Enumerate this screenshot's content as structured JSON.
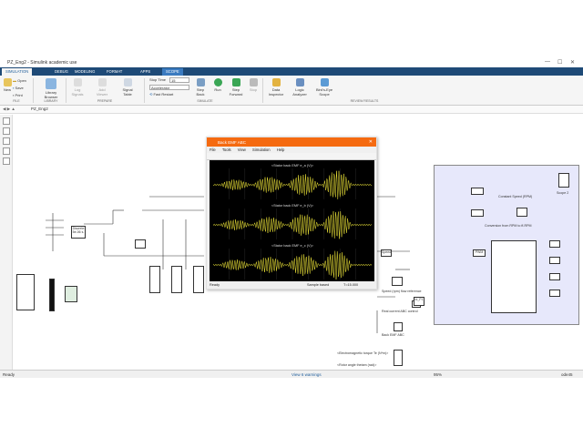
{
  "window": {
    "title": "PZ_Eng2 - Simulink academic use",
    "minimize": "—",
    "maximize": "☐",
    "close": "✕"
  },
  "tabs": [
    "SIMULATION",
    "DEBUG",
    "MODELING",
    "FORMAT",
    "APPS",
    "SCOPE"
  ],
  "active_tab": "SIMULATION",
  "ribbon": {
    "file": {
      "new": "New",
      "open": "Open",
      "save": "Save",
      "print": "Print",
      "section": "FILE"
    },
    "library": {
      "library_browser": "Library Browser",
      "section": "LIBRARY"
    },
    "prepare": {
      "log_signals": "Log Signals",
      "add_viewer": "Add Viewer",
      "signal_table": "Signal Table",
      "section": "PREPARE"
    },
    "simulate": {
      "stop_time_label": "Stop Time",
      "stop_time_value": "15",
      "mode": "Accelerator",
      "fast_restart": "Fast Restart",
      "step_back": "Step Back",
      "run": "Run",
      "step_forward": "Step Forward",
      "stop": "Stop",
      "section": "SIMULATE"
    },
    "review": {
      "data_inspector": "Data Inspector",
      "logic_analyzer": "Logic Analyzer",
      "birds_eye": "Bird's-Eye Scope",
      "section": "REVIEW RESULTS"
    }
  },
  "address": {
    "model": "PZ_Eng2"
  },
  "scope": {
    "title": "Back EMF ABC",
    "menu": [
      "File",
      "Tools",
      "View",
      "Simulation",
      "Help"
    ],
    "plots": [
      {
        "title": "<Stator back EMF e_a (V)>"
      },
      {
        "title": "<Stator back EMF e_b (V)>"
      },
      {
        "title": "<Stator back EMF e_c (V)>"
      }
    ],
    "status_left": "Ready",
    "status_mid": "Sample based",
    "status_right": "T=15.000"
  },
  "diagram": {
    "blocks": {
      "discrete": "Discrete\n5e-06 s.",
      "powergui": "powergui",
      "speed": "Speed",
      "speed_ref": "Speed (rpm) flow reference",
      "back_emf_abc": "Back EMF ABC",
      "electromagnetic": "<Electromagnetic torque Te (N*m)>",
      "rotor_angle": "<Rotor angle thetam (rad)>",
      "te_angle": "Te and Rotor angle",
      "measure": "Real current ABC control",
      "mi_pi": "Id_P1"
    },
    "subsystem": {
      "constant_speed": "Constant Speed (RPM)",
      "scope2": "Scope 2",
      "conv": "Conversion from RPM to ff-RPM",
      "pi_controller": "PWM",
      "ctrl_mode": "PI Controller"
    }
  },
  "status": {
    "left": "Ready",
    "center": "View 6 warnings",
    "zoom": "95%",
    "solver": "ode45"
  }
}
